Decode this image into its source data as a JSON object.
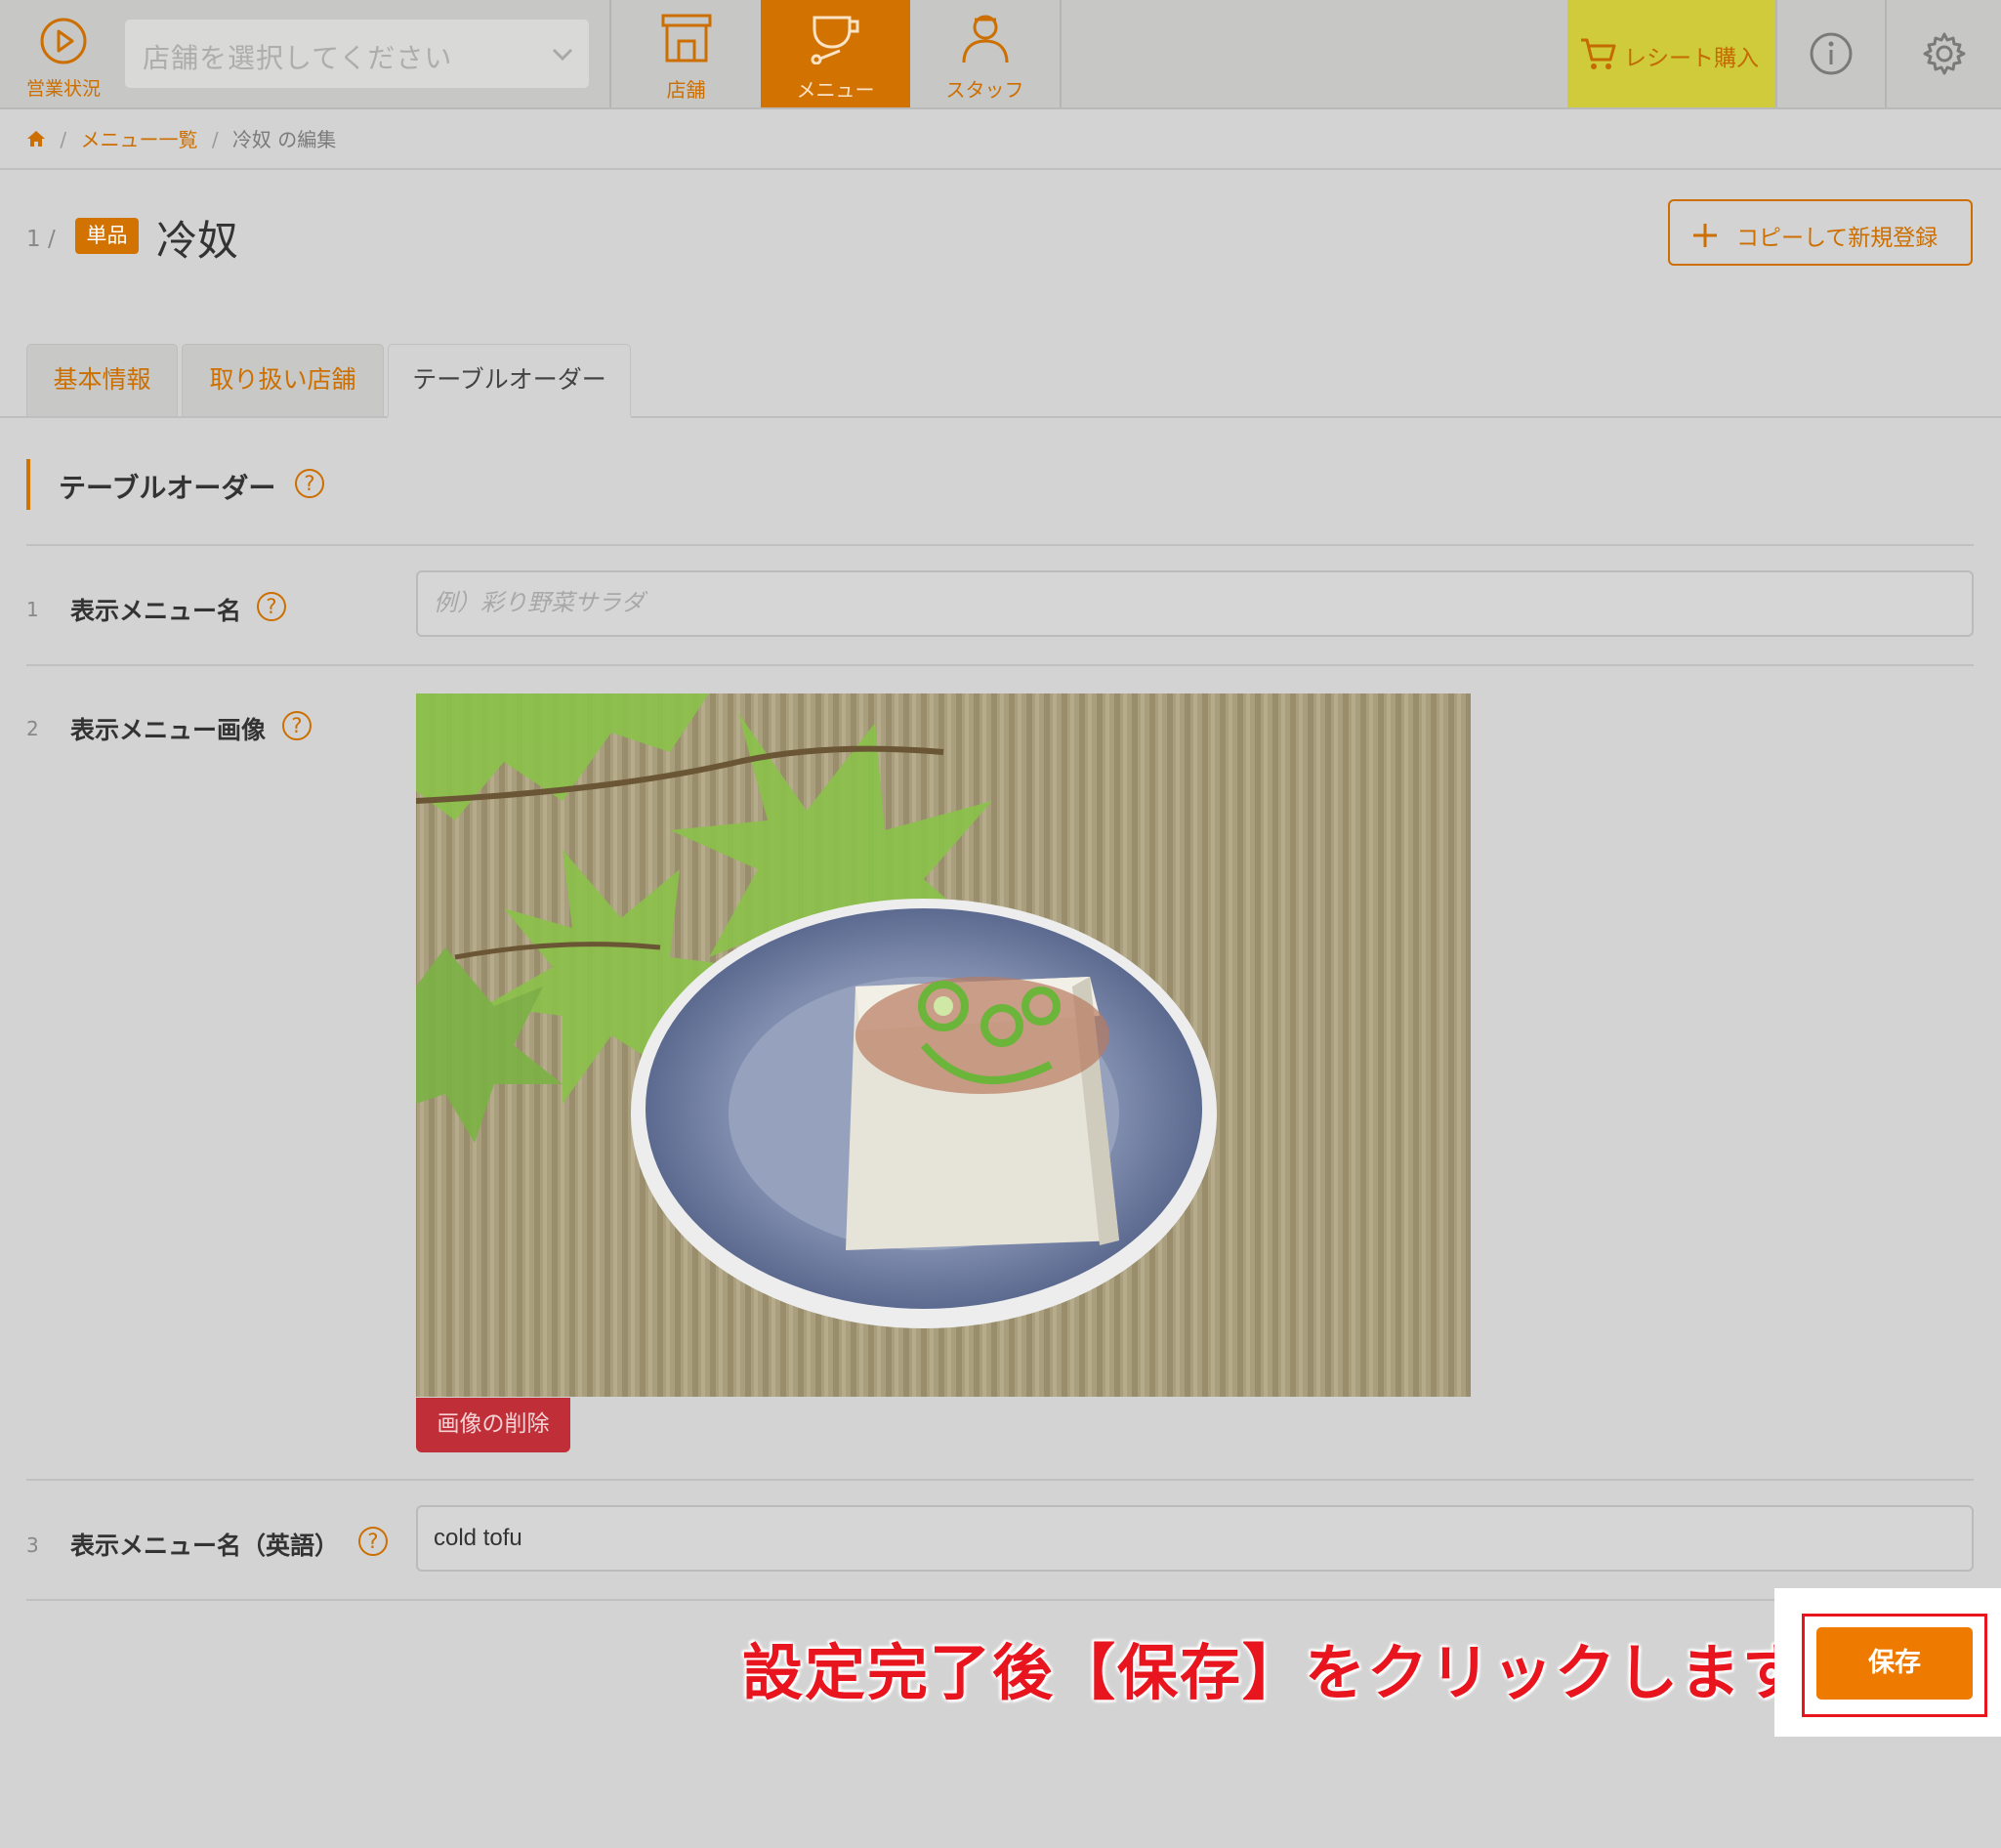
{
  "nav": {
    "status_label": "営業状況",
    "store_select_placeholder": "店舗を選択してください",
    "items": [
      {
        "label": "店舗",
        "icon": "store-icon"
      },
      {
        "label": "メニュー",
        "icon": "menu-cup-icon",
        "active": true
      },
      {
        "label": "スタッフ",
        "icon": "staff-person-icon"
      }
    ],
    "receipt_button": "レシート購入",
    "info_icon": "info-icon",
    "settings_icon": "gear-icon",
    "accent_color": "#d27200",
    "receipt_color": "#cfcb3b"
  },
  "breadcrumb": {
    "home_icon": "home-icon",
    "items": [
      "メニュー一覧",
      "冷奴 の編集"
    ]
  },
  "page": {
    "index": "1 /",
    "type_badge": "単品",
    "title": "冷奴",
    "copy_button": "コピーして新規登録"
  },
  "tabs": [
    {
      "label": "基本情報",
      "active": false
    },
    {
      "label": "取り扱い店舗",
      "active": false
    },
    {
      "label": "テーブルオーダー",
      "active": true
    }
  ],
  "section": {
    "title": "テーブルオーダー",
    "help": "?"
  },
  "fields": [
    {
      "num": "1",
      "label": "表示メニュー名",
      "placeholder": "例）彩り野菜サラダ",
      "value": ""
    },
    {
      "num": "2",
      "label": "表示メニュー画像",
      "delete_button": "画像の削除"
    },
    {
      "num": "3",
      "label": "表示メニュー名（英語）",
      "value": "cold tofu"
    }
  ],
  "annotation": {
    "callout_text": "設定完了後【保存】をクリックします",
    "color": "#e8141e"
  },
  "save_button": "保存"
}
